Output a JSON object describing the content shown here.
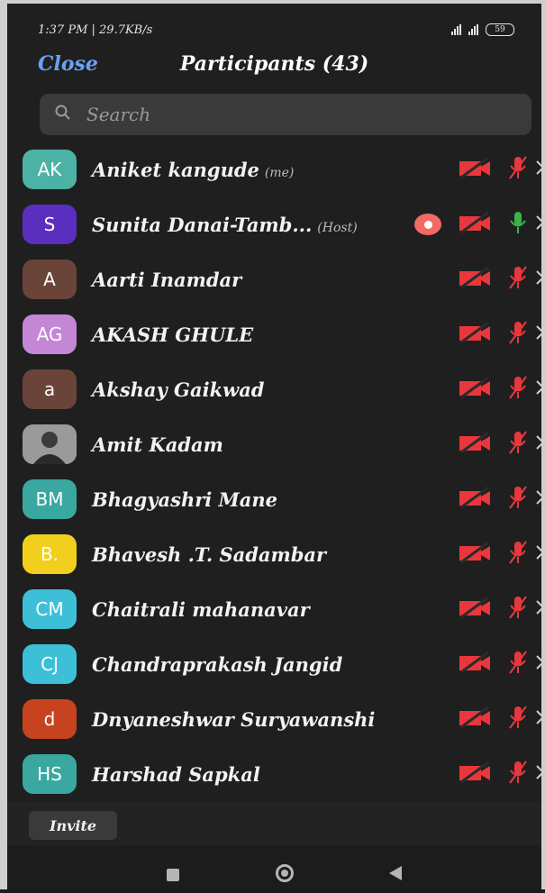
{
  "status_bar": {
    "time_speed": "1:37 PM | 29.7KB/s",
    "battery": "59"
  },
  "header": {
    "close_label": "Close",
    "title": "Participants (43)"
  },
  "search": {
    "placeholder": "Search"
  },
  "participants": [
    {
      "initials": "AK",
      "avatar_color": "#4db2a6",
      "name": "Aniket kangude",
      "tag": "(me)",
      "mic": "muted",
      "icon_color": "#e8383d"
    },
    {
      "initials": "S",
      "avatar_color": "#5a2fbf",
      "name": "Sunita Danai-Tamb...",
      "tag": "(Host)",
      "recording": true,
      "mic": "on",
      "mic_color": "#38b24a"
    },
    {
      "initials": "A",
      "avatar_color": "#6a4438",
      "name": "Aarti Inamdar",
      "mic": "muted"
    },
    {
      "initials": "AG",
      "avatar_color": "#c487d6",
      "name": "AKASH GHULE",
      "mic": "muted"
    },
    {
      "initials": "a",
      "avatar_color": "#6a4438",
      "name": "Akshay Gaikwad",
      "mic": "muted"
    },
    {
      "initials": "",
      "avatar_color": "#8a8a8a",
      "photo": true,
      "name": "Amit Kadam",
      "mic": "muted"
    },
    {
      "initials": "BM",
      "avatar_color": "#3aa8a0",
      "name": "Bhagyashri Mane",
      "mic": "muted"
    },
    {
      "initials": "B.",
      "avatar_color": "#f2cf1c",
      "name": "Bhavesh .T. Sadambar",
      "mic": "muted"
    },
    {
      "initials": "CM",
      "avatar_color": "#3dbfd8",
      "name": "Chaitrali mahanavar",
      "mic": "muted"
    },
    {
      "initials": "CJ",
      "avatar_color": "#3dbfd8",
      "name": "Chandraprakash Jangid",
      "mic": "muted"
    },
    {
      "initials": "d",
      "avatar_color": "#c7431f",
      "name": "Dnyaneshwar Suryawanshi",
      "mic": "muted"
    },
    {
      "initials": "HS",
      "avatar_color": "#3aa8a0",
      "name": "Harshad Sapkal",
      "mic": "muted"
    }
  ],
  "footer": {
    "invite_label": "Invite"
  }
}
